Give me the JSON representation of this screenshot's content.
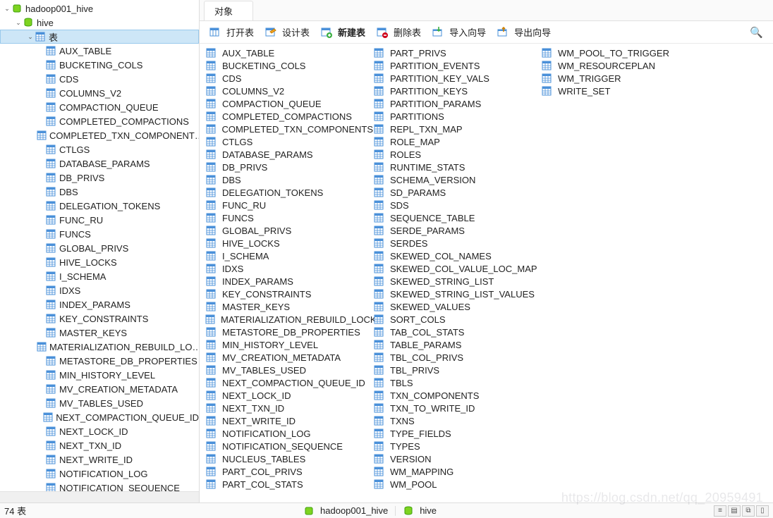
{
  "tree": {
    "connection": "hadoop001_hive",
    "database": "hive",
    "tables_node_label": "表",
    "tables": [
      "AUX_TABLE",
      "BUCKETING_COLS",
      "CDS",
      "COLUMNS_V2",
      "COMPACTION_QUEUE",
      "COMPLETED_COMPACTIONS",
      "COMPLETED_TXN_COMPONENT…",
      "CTLGS",
      "DATABASE_PARAMS",
      "DB_PRIVS",
      "DBS",
      "DELEGATION_TOKENS",
      "FUNC_RU",
      "FUNCS",
      "GLOBAL_PRIVS",
      "HIVE_LOCKS",
      "I_SCHEMA",
      "IDXS",
      "INDEX_PARAMS",
      "KEY_CONSTRAINTS",
      "MASTER_KEYS",
      "MATERIALIZATION_REBUILD_LO…",
      "METASTORE_DB_PROPERTIES",
      "MIN_HISTORY_LEVEL",
      "MV_CREATION_METADATA",
      "MV_TABLES_USED",
      "NEXT_COMPACTION_QUEUE_ID",
      "NEXT_LOCK_ID",
      "NEXT_TXN_ID",
      "NEXT_WRITE_ID",
      "NOTIFICATION_LOG",
      "NOTIFICATION_SEQUENCE"
    ]
  },
  "tab": {
    "label": "对象"
  },
  "toolbar": {
    "open_table": "打开表",
    "design_table": "设计表",
    "new_table": "新建表",
    "delete_table": "删除表",
    "import_wizard": "导入向导",
    "export_wizard": "导出向导"
  },
  "objects": [
    "AUX_TABLE",
    "BUCKETING_COLS",
    "CDS",
    "COLUMNS_V2",
    "COMPACTION_QUEUE",
    "COMPLETED_COMPACTIONS",
    "COMPLETED_TXN_COMPONENTS",
    "CTLGS",
    "DATABASE_PARAMS",
    "DB_PRIVS",
    "DBS",
    "DELEGATION_TOKENS",
    "FUNC_RU",
    "FUNCS",
    "GLOBAL_PRIVS",
    "HIVE_LOCKS",
    "I_SCHEMA",
    "IDXS",
    "INDEX_PARAMS",
    "KEY_CONSTRAINTS",
    "MASTER_KEYS",
    "MATERIALIZATION_REBUILD_LOCKS",
    "METASTORE_DB_PROPERTIES",
    "MIN_HISTORY_LEVEL",
    "MV_CREATION_METADATA",
    "MV_TABLES_USED",
    "NEXT_COMPACTION_QUEUE_ID",
    "NEXT_LOCK_ID",
    "NEXT_TXN_ID",
    "NEXT_WRITE_ID",
    "NOTIFICATION_LOG",
    "NOTIFICATION_SEQUENCE",
    "NUCLEUS_TABLES",
    "PART_COL_PRIVS",
    "PART_COL_STATS",
    "PART_PRIVS",
    "PARTITION_EVENTS",
    "PARTITION_KEY_VALS",
    "PARTITION_KEYS",
    "PARTITION_PARAMS",
    "PARTITIONS",
    "REPL_TXN_MAP",
    "ROLE_MAP",
    "ROLES",
    "RUNTIME_STATS",
    "SCHEMA_VERSION",
    "SD_PARAMS",
    "SDS",
    "SEQUENCE_TABLE",
    "SERDE_PARAMS",
    "SERDES",
    "SKEWED_COL_NAMES",
    "SKEWED_COL_VALUE_LOC_MAP",
    "SKEWED_STRING_LIST",
    "SKEWED_STRING_LIST_VALUES",
    "SKEWED_VALUES",
    "SORT_COLS",
    "TAB_COL_STATS",
    "TABLE_PARAMS",
    "TBL_COL_PRIVS",
    "TBL_PRIVS",
    "TBLS",
    "TXN_COMPONENTS",
    "TXN_TO_WRITE_ID",
    "TXNS",
    "TYPE_FIELDS",
    "TYPES",
    "VERSION",
    "WM_MAPPING",
    "WM_POOL",
    "WM_POOL_TO_TRIGGER",
    "WM_RESOURCEPLAN",
    "WM_TRIGGER",
    "WRITE_SET"
  ],
  "status": {
    "count_label": "74 表",
    "path_conn": "hadoop001_hive",
    "path_db": "hive"
  },
  "watermark": "https://blog.csdn.net/qq_20959491"
}
